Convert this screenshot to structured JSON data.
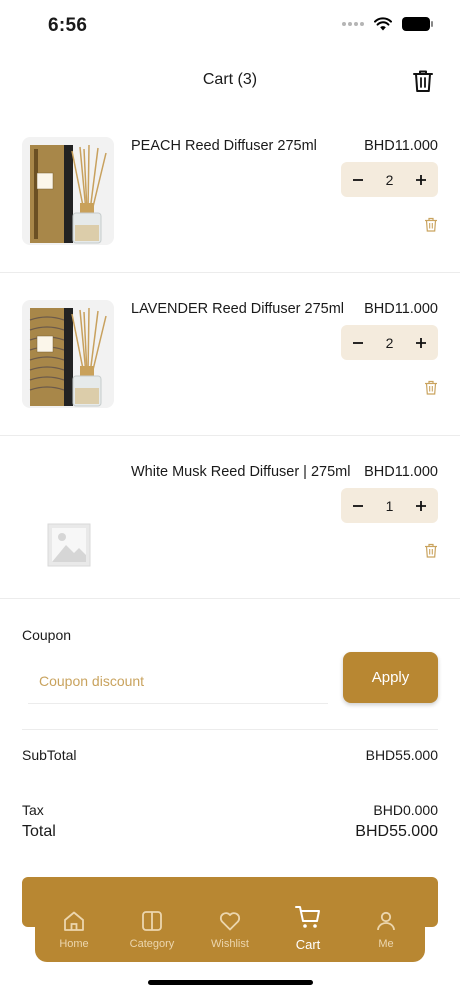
{
  "status_bar": {
    "time": "6:56"
  },
  "header": {
    "title": "Cart (3)",
    "clear_icon": "trash-icon"
  },
  "cart": {
    "items": [
      {
        "name": "PEACH Reed Diffuser 275ml",
        "price": "BHD11.000",
        "quantity": "2",
        "image": "reed-diffuser-product"
      },
      {
        "name": "LAVENDER Reed Diffuser 275ml",
        "price": "BHD11.000",
        "quantity": "2",
        "image": "reed-diffuser-product"
      },
      {
        "name": "White Musk  Reed Diffuser | 275ml",
        "price": "BHD11.000",
        "quantity": "1",
        "image": "image-placeholder"
      }
    ]
  },
  "coupon": {
    "label": "Coupon",
    "placeholder": "Coupon discount",
    "apply_label": "Apply"
  },
  "summary": {
    "subtotal_label": "SubTotal",
    "subtotal_value": "BHD55.000",
    "tax_label": "Tax",
    "tax_value": "BHD0.000",
    "total_label": "Total",
    "total_value": "BHD55.000"
  },
  "nav": {
    "items": [
      {
        "label": "Home",
        "icon": "home-icon"
      },
      {
        "label": "Category",
        "icon": "category-icon"
      },
      {
        "label": "Wishlist",
        "icon": "heart-icon"
      },
      {
        "label": "Cart",
        "icon": "cart-icon",
        "active": true
      },
      {
        "label": "Me",
        "icon": "user-icon"
      }
    ]
  },
  "colors": {
    "accent": "#b88732",
    "qty_bg": "#f4ebdd",
    "placeholder": "#c9a35e",
    "divider": "#ececec"
  }
}
